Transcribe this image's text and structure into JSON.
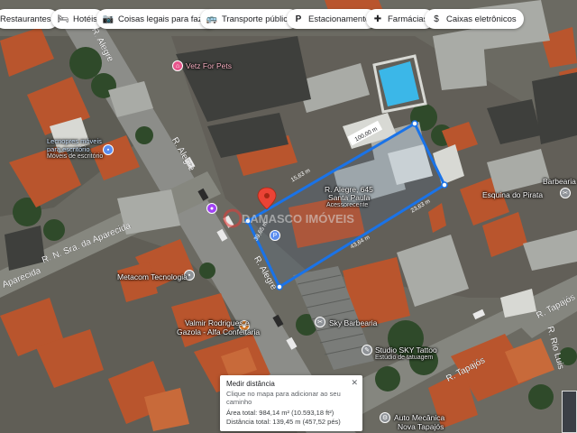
{
  "chips": [
    {
      "label": "Restaurantes",
      "icon": "restaurant-icon"
    },
    {
      "label": "Hotéis",
      "icon": "hotel-icon"
    },
    {
      "label": "Coisas legais para fazer",
      "icon": "camera-icon"
    },
    {
      "label": "Transporte público",
      "icon": "transit-icon"
    },
    {
      "label": "Estacionamento",
      "icon": "parking-icon"
    },
    {
      "label": "Farmácias",
      "icon": "pharmacy-icon"
    },
    {
      "label": "Caixas eletrônicos",
      "icon": "atm-icon"
    }
  ],
  "map": {
    "places": {
      "vetz": "Vetz For Pets",
      "ra_alegre_645": "R. Alegre, 645",
      "ra_alegre_645_sub": "Santa Paula",
      "acesso": "Acessorecente",
      "lecnopres": "Lecnopres móveis",
      "lecnopres_sub": "para escritório",
      "lecnopres_sub2": "Móveis de escritório",
      "metacom": "Metacom Tecnologia",
      "valmir": "Valmir Rodrigues e",
      "valmir2": "Gazola - Alfa Confeitaria",
      "sky_barb": "Sky Barbearia",
      "studio": "Studio SKY Tattoo",
      "studio_sub": "Estúdio de tatuagem",
      "barbearia": "Barbearia",
      "pirata": "Esquina do Pirata",
      "auto": "Auto Mecânica",
      "auto2": "Nova Tapajós",
      "watermark": "DAMASCO IMÓVEIS"
    },
    "roads": {
      "r_alegre": "R. Alegre",
      "r_alegre_b": "R. Alegre",
      "r_alegre_c": "R. Alegre",
      "aparecida": "R. N. Sra. da Aparecida",
      "aparecida_b": "Aparecida",
      "tapajos": "R. Tapajós",
      "tapajos_b": "R. Tapajós",
      "rio_luis": "R. Rio Luis"
    },
    "measure_labels": {
      "seg_top": "100,00 m",
      "seg_a": "15,63 m",
      "seg_b": "23,63 m",
      "seg_c": "43,64 m",
      "seg_d": "39,65 m"
    }
  },
  "measure_card": {
    "title": "Medir distância",
    "hint": "Clique no mapa para adicionar ao seu caminho",
    "area": "Área total: 984,14 m² (10.593,18 ft²)",
    "distance": "Distância total: 139,45 m (457,52 pés)",
    "close": "✕"
  },
  "colors": {
    "measure_line": "#1a73e8",
    "pin": "#ea4335",
    "roof": "#c0582f",
    "street": "#8c8d89"
  }
}
